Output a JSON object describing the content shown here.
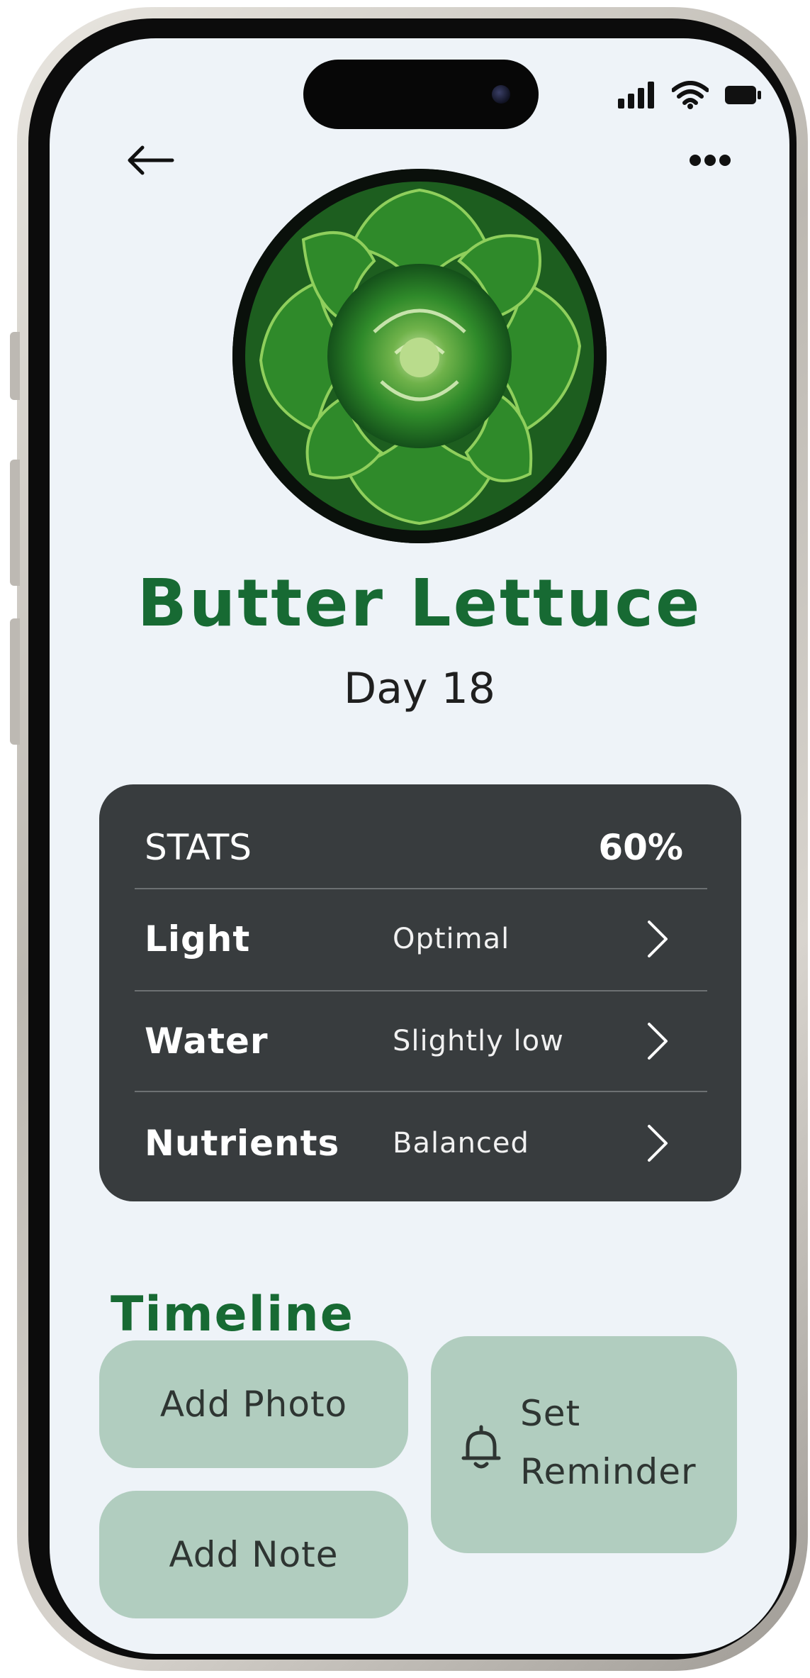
{
  "header": {
    "back_icon": "arrow-left-icon",
    "more_icon": "more-dots-icon"
  },
  "status_bar": {
    "icons": [
      "signal-icon",
      "wifi-icon",
      "battery-icon"
    ]
  },
  "plant": {
    "photo_alt": "lettuce-photo",
    "name": "Butter Lettuce",
    "day": "Day 18"
  },
  "stats": {
    "title": "STATS",
    "percent": "60%",
    "rows": [
      {
        "label": "Light",
        "value": "Optimal"
      },
      {
        "label": "Water",
        "value": "Slightly low"
      },
      {
        "label": "Nutrients",
        "value": "Balanced"
      }
    ]
  },
  "timeline": {
    "title": "Timeline",
    "add_photo": "Add Photo",
    "add_note": "Add Note",
    "reminder_line1": "Set",
    "reminder_line2": "Reminder",
    "reminder_icon": "bell-icon"
  },
  "colors": {
    "screen_bg": "#eef3f8",
    "accent_green": "#176a33",
    "card_dark": "#383c3e",
    "button_green": "#b1cdbf"
  }
}
